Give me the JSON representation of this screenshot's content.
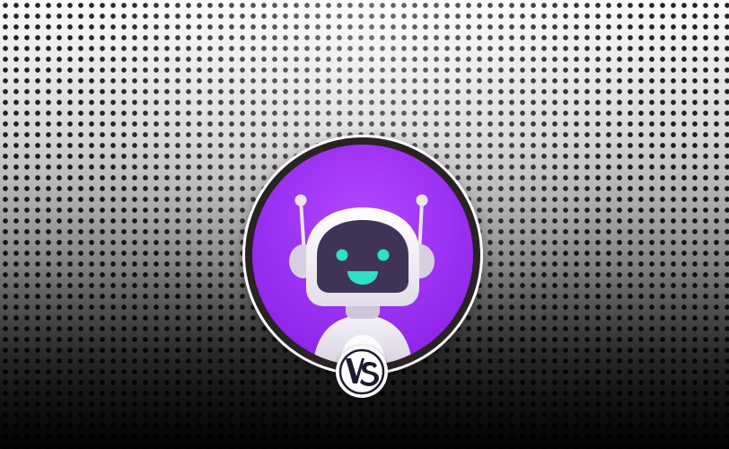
{
  "scene": {
    "background": "perforated-metal-pattern",
    "colors": {
      "top": "#fafafa",
      "bottom": "#060606",
      "avatar_fill": "#a12ff5",
      "avatar_ring": "#2b2224",
      "robot_face": "#3f3456",
      "robot_features": "#2de0c7"
    }
  },
  "avatar": {
    "icon": "robot-icon"
  },
  "badge": {
    "icon": "versus-icon",
    "logo_text": "VS"
  }
}
